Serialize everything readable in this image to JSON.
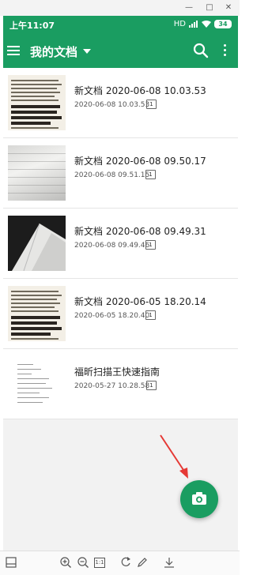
{
  "window": {
    "minimize": "—",
    "maximize": "□",
    "close": "✕"
  },
  "status": {
    "time": "上午11:07",
    "signal": "HD",
    "battery": "34"
  },
  "appbar": {
    "title": "我的文档"
  },
  "documents": [
    {
      "name": "新文档 2020-06-08 10.03.53",
      "date": "2020-06-08 10.03.53",
      "pages": "1",
      "thumb": "newspaper"
    },
    {
      "name": "新文档 2020-06-08 09.50.17",
      "date": "2020-06-08 09.51.15",
      "pages": "1",
      "thumb": "paper"
    },
    {
      "name": "新文档 2020-06-08 09.49.31",
      "date": "2020-06-08 09.49.46",
      "pages": "1",
      "thumb": "dark"
    },
    {
      "name": "新文档 2020-06-05 18.20.14",
      "date": "2020-06-05 18.20.40",
      "pages": "1",
      "thumb": "newspaper"
    },
    {
      "name": "福昕扫描王快速指南",
      "date": "2020-05-27 10.28.58",
      "pages": "1",
      "thumb": "guide"
    }
  ],
  "bottom_toolbar": {
    "fit_label": "1:1"
  },
  "colors": {
    "brand": "#1a9d61",
    "arrow": "#e53935"
  }
}
